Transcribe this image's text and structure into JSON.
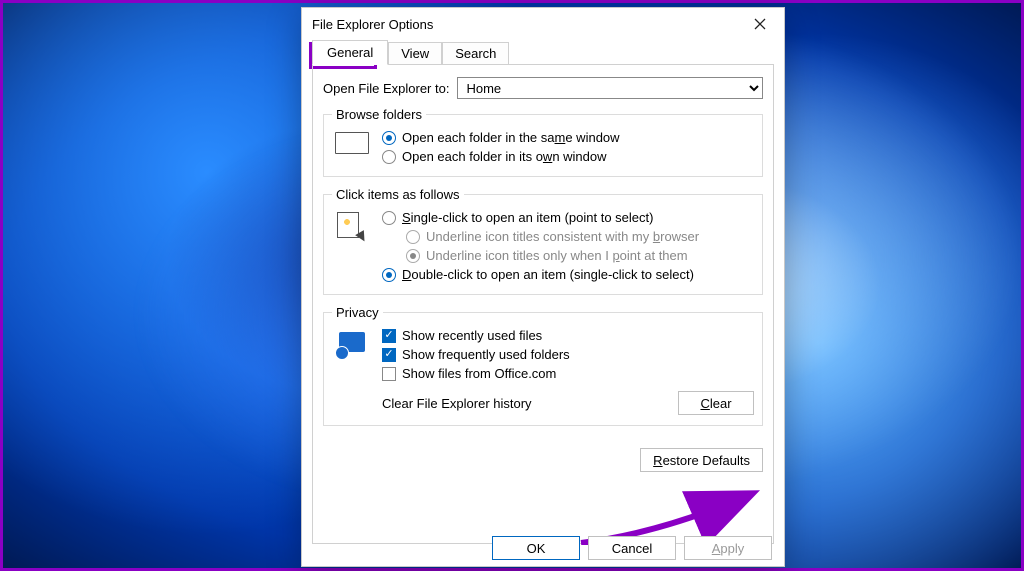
{
  "dialog": {
    "title": "File Explorer Options",
    "tabs": [
      "General",
      "View",
      "Search"
    ],
    "active_tab": 0,
    "open_to_label": "Open File Explorer to:",
    "open_to_value": "Home",
    "browse": {
      "legend": "Browse folders",
      "opt_same": "Open each folder in the same window",
      "opt_own": "Open each folder in its own window",
      "selected": 0
    },
    "click": {
      "legend": "Click items as follows",
      "opt_single": "Single-click to open an item (point to select)",
      "opt_underline_browser": "Underline icon titles consistent with my browser",
      "opt_underline_point": "Underline icon titles only when I point at them",
      "opt_double": "Double-click to open an item (single-click to select)"
    },
    "privacy": {
      "legend": "Privacy",
      "recent": "Show recently used files",
      "frequent": "Show frequently used folders",
      "office": "Show files from Office.com",
      "clear_label": "Clear File Explorer history",
      "clear_btn": "Clear"
    },
    "restore": "Restore Defaults",
    "footer": {
      "ok": "OK",
      "cancel": "Cancel",
      "apply": "Apply"
    }
  },
  "highlight": {
    "color": "#8a00c4"
  }
}
